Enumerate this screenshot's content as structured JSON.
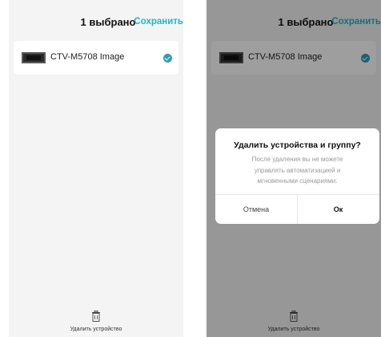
{
  "left_screen": {
    "header": {
      "title": "1 выбрано",
      "save_label": "Сохранить"
    },
    "device": {
      "name": "CTV-M5708 Image",
      "selected": true
    },
    "bottom_action": {
      "label": "Удалить устройство",
      "icon": "trash-icon"
    }
  },
  "right_screen": {
    "header": {
      "title": "1 выбрано",
      "save_label": "Сохранить"
    },
    "device": {
      "name": "CTV-M5708 Image",
      "selected": true
    },
    "dialog": {
      "title": "Удалить устройства и группу?",
      "message_lines": [
        "После удаления вы не можете",
        "управлять автоматизацией и",
        "мгновенными сценариями."
      ],
      "cancel_label": "Отмена",
      "ok_label": "Ок"
    },
    "bottom_action": {
      "label": "Удалить устройство",
      "icon": "trash-icon"
    }
  },
  "colors": {
    "accent": "#2ab3c3",
    "check": "#2a9fb6",
    "background": "#f4f4f4"
  }
}
